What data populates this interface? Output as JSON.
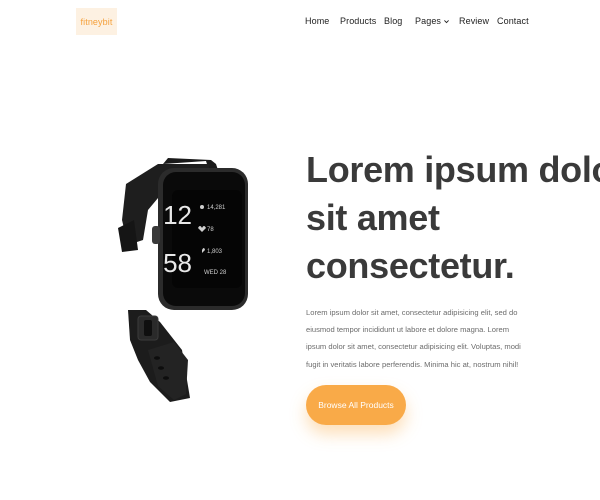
{
  "brand": {
    "logo_text": "fitneybit"
  },
  "nav": {
    "items": [
      {
        "label": "Home"
      },
      {
        "label": "Products"
      },
      {
        "label": "Blog"
      },
      {
        "label": "Pages",
        "icon": "chevron-down-icon"
      },
      {
        "label": "Review"
      },
      {
        "label": "Contact"
      }
    ]
  },
  "hero": {
    "title_lines": [
      "Lorem ipsum dolor",
      "sit amet",
      "consectetur."
    ],
    "description": "Lorem ipsum dolor sit amet, consectetur adipisicing elit, sed do eiusmod tempor incididunt ut labore et dolore magna. Lorem ipsum dolor sit amet, consectetur adipisicing elit. Voluptas, modi fugit in veritatis labore perferendis. Minima hic at, nostrum nihil!",
    "cta_label": "Browse All Products"
  },
  "watch_screen": {
    "time_hours": "12",
    "time_minutes": "58",
    "steps": "14,281",
    "heart_rate": "78",
    "calories": "1,803",
    "date": "WED 28"
  },
  "colors": {
    "accent": "#f9aa48",
    "logo_bg": "#fdf1e2",
    "logo_text": "#f5a13c",
    "heading": "#3a3a3a"
  }
}
